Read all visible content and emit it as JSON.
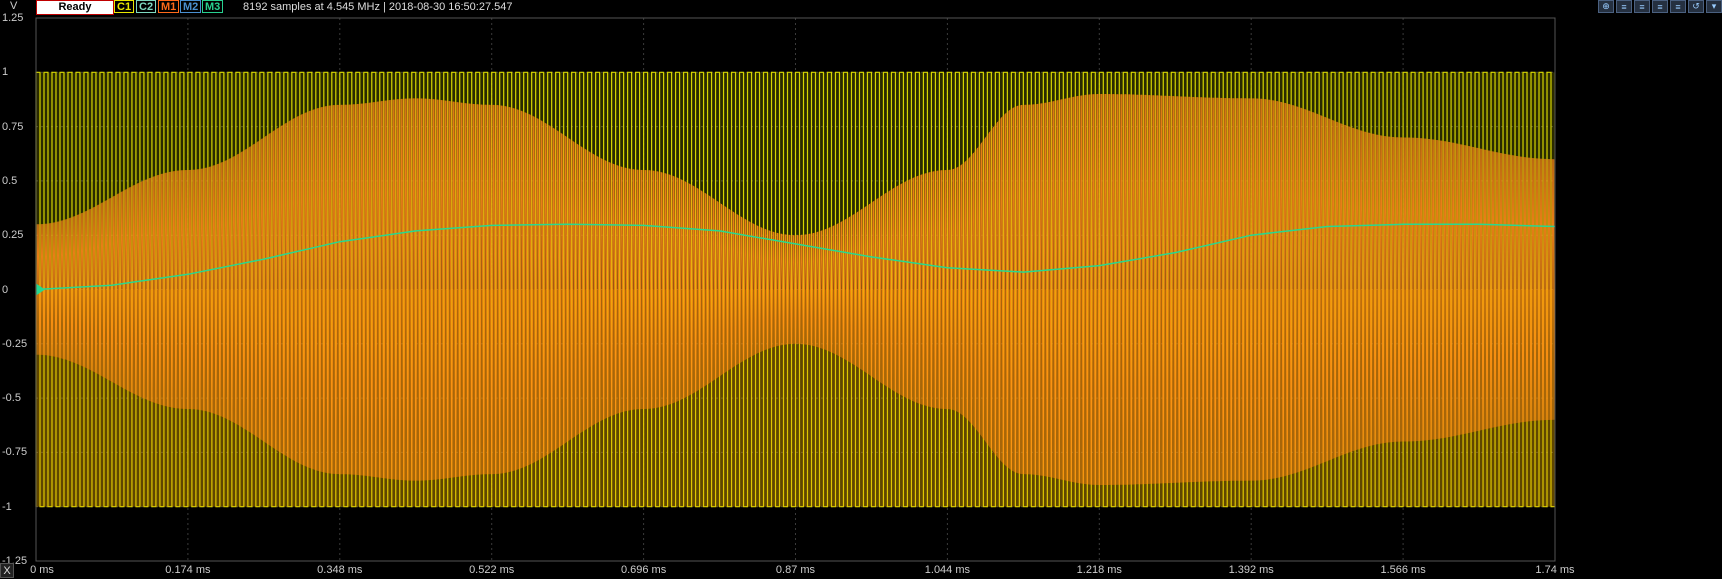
{
  "toolbar": {
    "y_unit": "V",
    "status": "Ready",
    "channels": [
      {
        "label": "C1",
        "color": "#e8e800"
      },
      {
        "label": "C2",
        "color": "#7fd9c0"
      },
      {
        "label": "M1",
        "color": "#ff6a1a"
      },
      {
        "label": "M2",
        "color": "#4a8fd0"
      },
      {
        "label": "M3",
        "color": "#28d090"
      }
    ],
    "info": "8192 samples at 4.545 MHz | 2018-08-30 16:50:27.547",
    "icons": [
      "zoom-in-icon",
      "align-icon",
      "align-icon",
      "align-icon",
      "align-icon",
      "restore-icon",
      "more-icon"
    ]
  },
  "x_axis_button": "X",
  "chart_data": {
    "type": "line",
    "title": "",
    "xlabel": "",
    "ylabel": "V",
    "x_unit": "ms",
    "xlim": [
      0,
      1.74
    ],
    "ylim": [
      -1.25,
      1.25
    ],
    "x_ticks": [
      "0 ms",
      "0.174 ms",
      "0.348 ms",
      "0.522 ms",
      "0.696 ms",
      "0.87 ms",
      "1.044 ms",
      "1.218 ms",
      "1.392 ms",
      "1.566 ms",
      "1.74 ms"
    ],
    "y_ticks": [
      "1.25",
      "1",
      "0.75",
      "0.5",
      "0.25",
      "0",
      "-0.25",
      "-0.5",
      "-0.75",
      "-1",
      "-1.25"
    ],
    "grid": true,
    "series": [
      {
        "name": "C1",
        "color": "#e8e800",
        "description": "square-wave carrier",
        "x": [
          0,
          1.74
        ],
        "y_range": [
          -1,
          1
        ]
      },
      {
        "name": "M1",
        "color": "#ff8a1a",
        "description": "AM-modulated carrier",
        "envelope_x": [
          0,
          0.174,
          0.348,
          0.435,
          0.522,
          0.696,
          0.87,
          1.044,
          1.131,
          1.218,
          1.392,
          1.566,
          1.74
        ],
        "envelope_y": [
          0.3,
          0.55,
          0.85,
          0.88,
          0.85,
          0.55,
          0.25,
          0.55,
          0.85,
          0.9,
          0.88,
          0.7,
          0.6
        ]
      },
      {
        "name": "M3",
        "color": "#28d890",
        "x": [
          0,
          0.087,
          0.174,
          0.261,
          0.348,
          0.435,
          0.522,
          0.609,
          0.696,
          0.783,
          0.87,
          0.957,
          1.044,
          1.131,
          1.218,
          1.305,
          1.392,
          1.479,
          1.566,
          1.653,
          1.74
        ],
        "y": [
          0.0,
          0.02,
          0.07,
          0.14,
          0.22,
          0.27,
          0.295,
          0.3,
          0.295,
          0.27,
          0.21,
          0.15,
          0.1,
          0.08,
          0.11,
          0.17,
          0.25,
          0.29,
          0.3,
          0.3,
          0.29
        ]
      }
    ]
  }
}
